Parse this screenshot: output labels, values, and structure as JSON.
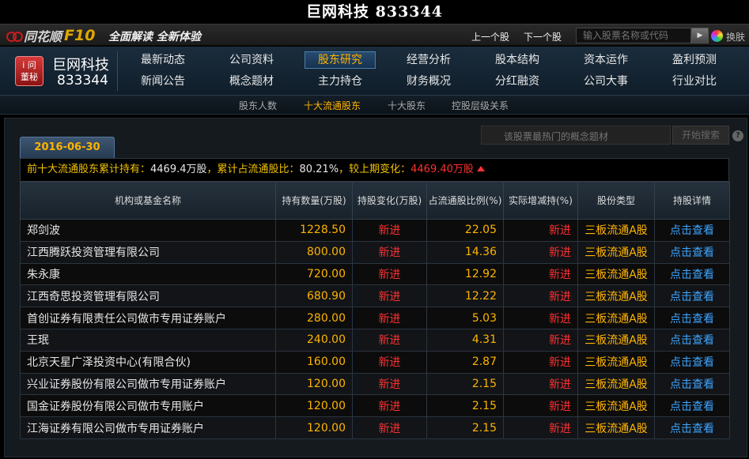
{
  "window_title": "巨网科技 833344",
  "brand": {
    "name": "同花顺",
    "product": "F10",
    "slogan": "全面解读 全新体验"
  },
  "topbar": {
    "prev_label": "上一个股",
    "next_label": "下一个股",
    "search_placeholder": "输入股票名称或代码",
    "skin_label": "换肤"
  },
  "stock": {
    "badge_line1": "i 问",
    "badge_line2": "董秘",
    "name": "巨网科技",
    "code": "833344"
  },
  "nav": {
    "row1": [
      "最新动态",
      "公司资料",
      "股东研究",
      "经营分析",
      "股本结构",
      "资本运作",
      "盈利预测"
    ],
    "row2": [
      "新闻公告",
      "概念题材",
      "主力持仓",
      "财务概况",
      "分红融资",
      "公司大事",
      "行业对比"
    ],
    "active": "股东研究"
  },
  "subnav": {
    "items": [
      "股东人数",
      "十大流通股东",
      "十大股东",
      "控股层级关系"
    ],
    "active": "十大流通股东"
  },
  "concept_search": {
    "placeholder": "该股票最热门的概念题材",
    "button": "开始搜索",
    "help": "?"
  },
  "date_tab": "2016-06-30",
  "summary": {
    "label1": "前十大流通股东累计持有：",
    "value1": "4469.4万股",
    "label2": "，累计占流通股比：",
    "value2": "80.21%",
    "label3": "，较上期变化：",
    "value3": "4469.40万股"
  },
  "table": {
    "headers": [
      "机构或基金名称",
      "持有数量(万股)",
      "持股变化(万股)",
      "占流通股比例(%)",
      "实际增减持(%)",
      "股份类型",
      "持股详情"
    ],
    "rows": [
      [
        "郑剑波",
        "1228.50",
        "新进",
        "22.05",
        "新进",
        "三板流通A股",
        "点击查看"
      ],
      [
        "江西腾跃投资管理有限公司",
        "800.00",
        "新进",
        "14.36",
        "新进",
        "三板流通A股",
        "点击查看"
      ],
      [
        "朱永康",
        "720.00",
        "新进",
        "12.92",
        "新进",
        "三板流通A股",
        "点击查看"
      ],
      [
        "江西奇思投资管理有限公司",
        "680.90",
        "新进",
        "12.22",
        "新进",
        "三板流通A股",
        "点击查看"
      ],
      [
        "首创证券有限责任公司做市专用证券账户",
        "280.00",
        "新进",
        "5.03",
        "新进",
        "三板流通A股",
        "点击查看"
      ],
      [
        "王珉",
        "240.00",
        "新进",
        "4.31",
        "新进",
        "三板流通A股",
        "点击查看"
      ],
      [
        "北京天星广泽投资中心(有限合伙)",
        "160.00",
        "新进",
        "2.87",
        "新进",
        "三板流通A股",
        "点击查看"
      ],
      [
        "兴业证券股份有限公司做市专用证券账户",
        "120.00",
        "新进",
        "2.15",
        "新进",
        "三板流通A股",
        "点击查看"
      ],
      [
        "国金证券股份有限公司做市专用账户",
        "120.00",
        "新进",
        "2.15",
        "新进",
        "三板流通A股",
        "点击查看"
      ],
      [
        "江海证券有限公司做市专用证券账户",
        "120.00",
        "新进",
        "2.15",
        "新进",
        "三板流通A股",
        "点击查看"
      ]
    ]
  }
}
